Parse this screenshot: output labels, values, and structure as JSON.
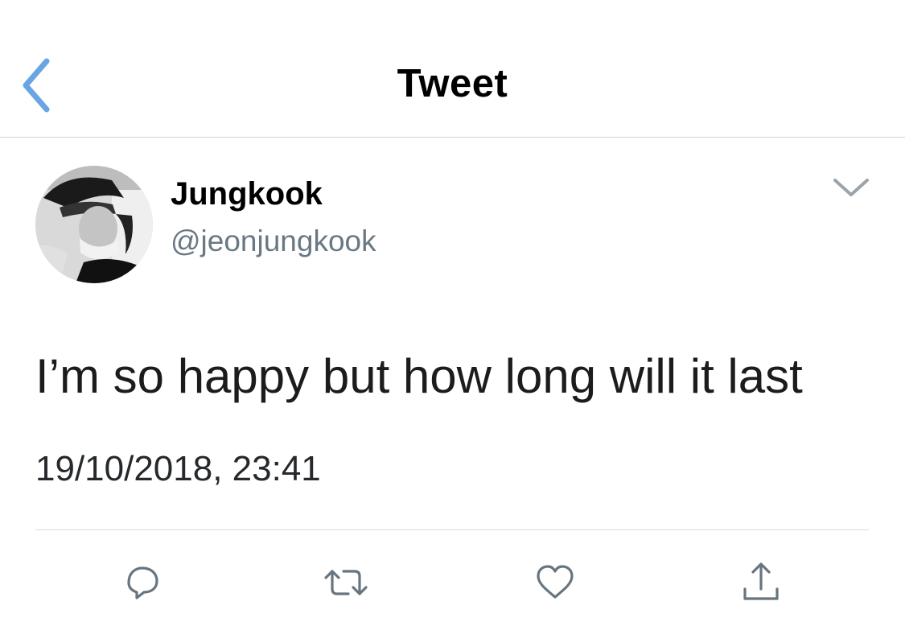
{
  "nav": {
    "title": "Tweet",
    "back_icon": "chevron-left-icon",
    "accent_color": "#6aa5e3"
  },
  "tweet": {
    "author": {
      "display_name": "Jungkook",
      "handle": "@jeonjungkook",
      "avatar": "avatar-photo"
    },
    "text": "I’m so happy but how long will it last",
    "timestamp": "19/10/2018, 23:41",
    "more_icon": "chevron-down-icon"
  },
  "actions": [
    {
      "name": "reply",
      "icon": "reply-icon"
    },
    {
      "name": "retweet",
      "icon": "retweet-icon"
    },
    {
      "name": "like",
      "icon": "heart-icon"
    },
    {
      "name": "share",
      "icon": "share-icon"
    }
  ],
  "colors": {
    "handle": "#697883",
    "icon_gray": "#66757f",
    "divider": "#d5d9dc"
  }
}
